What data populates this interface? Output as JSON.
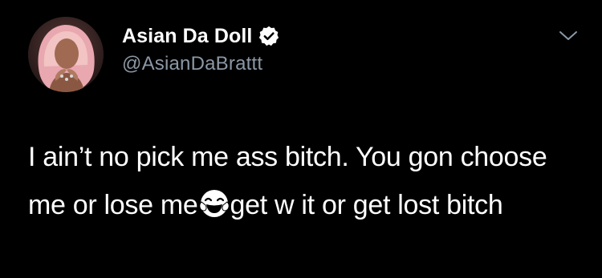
{
  "tweet": {
    "author": {
      "display_name": "Asian Da Doll",
      "handle": "@AsianDaBrattt",
      "verified": true,
      "avatar_icon": "profile-photo"
    },
    "menu_icon": "chevron-down-icon",
    "text_before_emoji": "I ain’t no pick me ass bitch. You gon choose me or lose me",
    "emoji": "face-with-tears-of-joy-emoji",
    "text_after_emoji": "get w it or get lost bitch"
  },
  "colors": {
    "background": "#000000",
    "text": "#ffffff",
    "handle": "#8b98a5",
    "verified_badge": "#ffffff",
    "chevron": "#8b98a5"
  }
}
